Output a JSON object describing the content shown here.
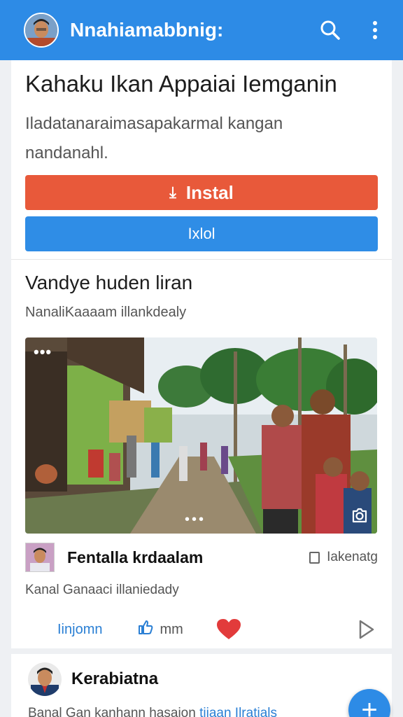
{
  "appbar": {
    "title": "Nnahiamabbnig:",
    "avatar_icon": "profile-avatar",
    "search_icon": "search-icon",
    "menu_icon": "more-vert-icon",
    "color": "#2d8be6"
  },
  "promo": {
    "headline": "Kahaku Ikan Appaiai Iemganin",
    "description": "Iladatanaraimasapakarmal kangan nandanahl.",
    "install_label": "Instal",
    "install_icon": "download-icon",
    "secondary_label": "Ixlol",
    "install_color": "#e8593a",
    "secondary_color": "#2f8de6"
  },
  "video": {
    "section_title": "Vandye huden liran",
    "section_subtitle": "NanaliKaaaam illankdealy",
    "thumbnail_icon": "village-scene-image",
    "more_label": "•••",
    "pager_label": "•••",
    "camera_icon": "camera-icon",
    "channel_name": "Fentalla krdaalam",
    "channel_tag": "Iakenatg",
    "channel_meta": "Kanal Ganaaci illaniedady",
    "views_label": "Iinjomn",
    "like_count": "mm",
    "like_icon": "thumbs-up-icon",
    "heart_icon": "heart-icon",
    "play_icon": "play-icon"
  },
  "next": {
    "name": "Kerabiatna",
    "text": "Banal Gan kanhann hasaion",
    "link": "tiiaan Ilratials"
  },
  "fab": {
    "label": "+"
  }
}
